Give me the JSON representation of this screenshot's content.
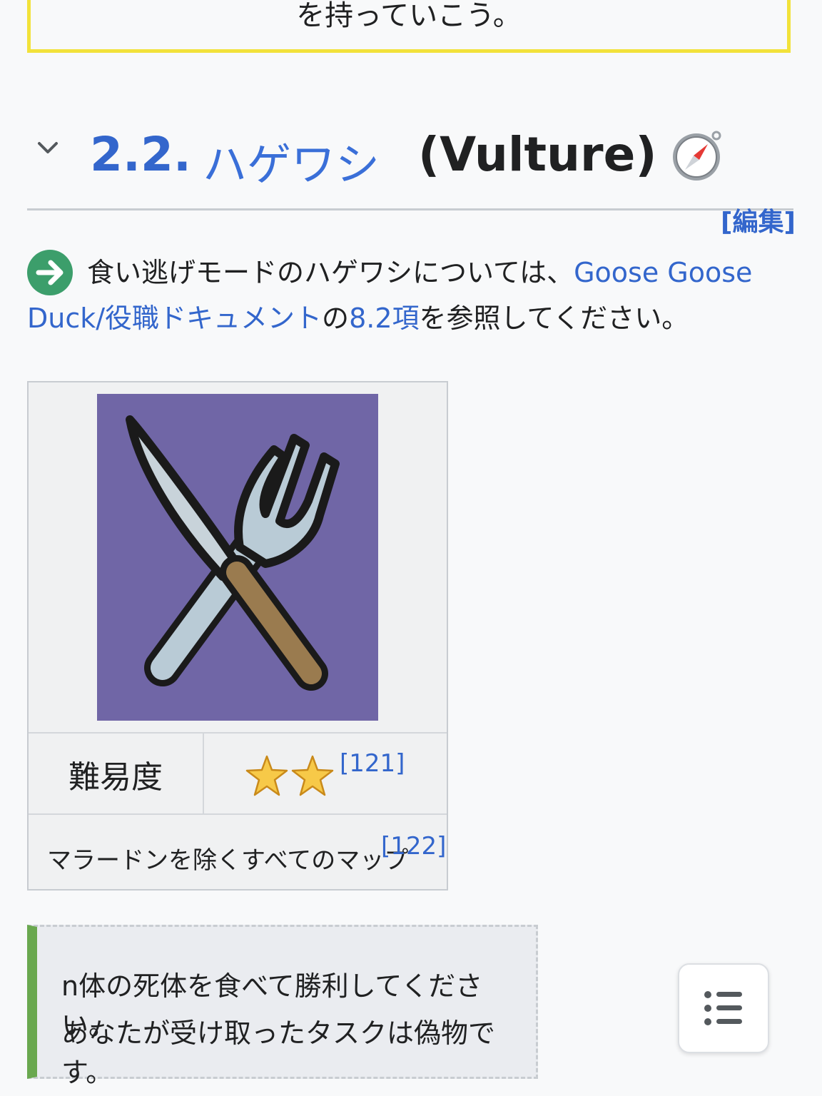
{
  "top_box": {
    "text": "を持っていこう。"
  },
  "heading": {
    "number": "2.2.",
    "name": "ハゲワシ",
    "latin": "(Vulture)",
    "edit_label": "[編集]",
    "icon": "compass-icon"
  },
  "intro": {
    "icon": "arrow-right-circle-icon",
    "text_before": "食い逃げモードのハゲワシについては、",
    "link1": "Goose Goose Duck/役職ドキュメント",
    "text_mid": "の",
    "link2": "8.2項",
    "text_after": "を参照してください。"
  },
  "infobox": {
    "image": "knife-and-fork-icon",
    "difficulty_label": "難易度",
    "difficulty_stars": 2,
    "difficulty_ref": "[121]",
    "maps_text": "マラードンを除くすべてのマップ",
    "maps_ref": "[122]"
  },
  "goal_box": {
    "line1": "n体の死体を食べて勝利してください。",
    "line2": "あなたが受け取ったタスクは偽物です。"
  },
  "toc_button": {
    "icon": "list-icon"
  },
  "colors": {
    "link": "#3366cc",
    "accent_green": "#6aa84f",
    "yellow_border": "#f2e23a",
    "image_bg": "#7066a6"
  }
}
